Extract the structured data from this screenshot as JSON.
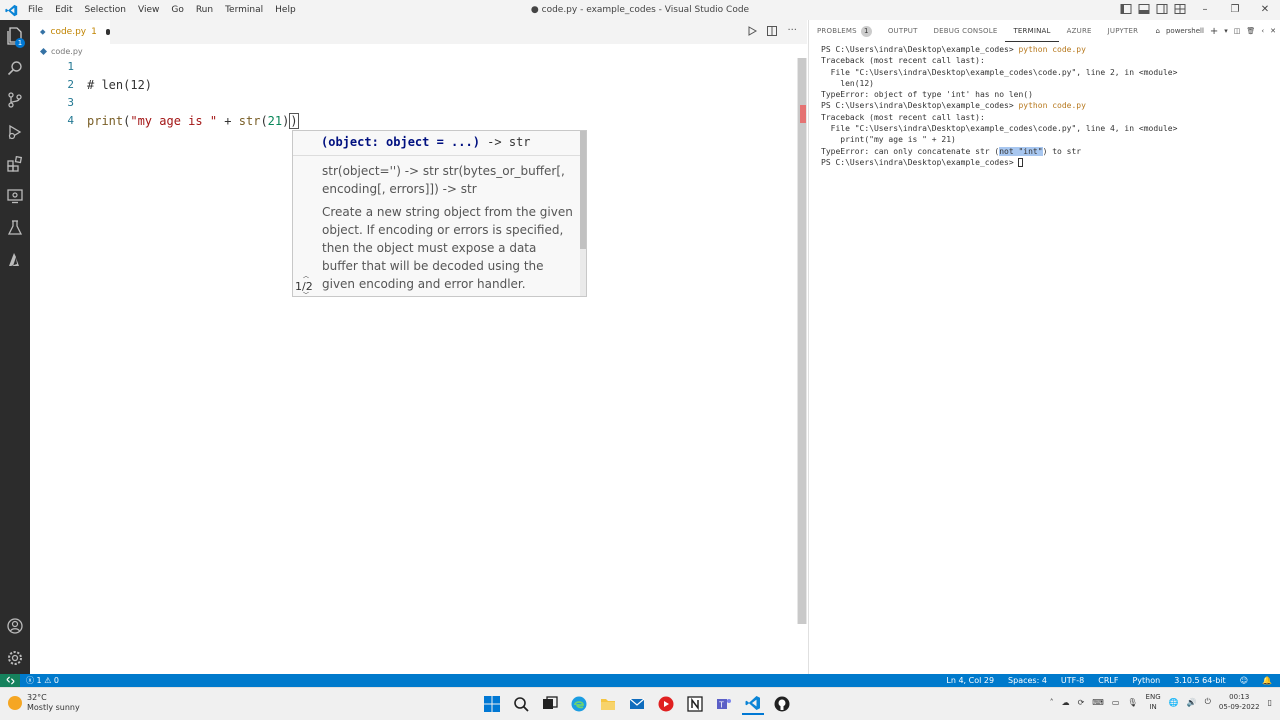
{
  "window": {
    "title": "● code.py - example_codes - Visual Studio Code",
    "menu": [
      "File",
      "Edit",
      "Selection",
      "View",
      "Go",
      "Run",
      "Terminal",
      "Help"
    ]
  },
  "activity_bar": {
    "explorer_badge": "1",
    "items": [
      "explorer-icon",
      "search-icon",
      "source-control-icon",
      "run-debug-icon",
      "extensions-icon",
      "remote-explorer-icon",
      "testing-icon",
      "azure-icon",
      "account-icon",
      "settings-gear-icon"
    ]
  },
  "editor": {
    "tab": {
      "filename": "code.py",
      "problem_count": "1"
    },
    "breadcrumb": "code.py",
    "lines": [
      {
        "number": "1",
        "text": ""
      },
      {
        "number": "2",
        "text": "# len(12)"
      },
      {
        "number": "3",
        "text": ""
      },
      {
        "number": "4",
        "text": "print(\"my age is \" + str(21))"
      }
    ],
    "line4": {
      "fn": "print",
      "open": "(",
      "str": "\"my age is \"",
      "plus": " + ",
      "str_fn": "str",
      "open2": "(",
      "num": "21",
      "close2": ")",
      "close": ")"
    },
    "hover": {
      "sig_param": "(object: object = ...)",
      "sig_ret": " -> str",
      "overloads": "str(object='') -> str str(bytes_or_buffer[, encoding[, errors]]) -> str",
      "doc": "Create a new string object from the given object. If encoding or errors is specified, then the object must expose a data buffer that will be decoded using the given encoding and error handler. Otherwise, returns the result of object.__str__() (if",
      "pager": "1/2"
    }
  },
  "panel": {
    "tabs": [
      "PROBLEMS",
      "OUTPUT",
      "DEBUG CONSOLE",
      "TERMINAL",
      "AZURE",
      "JUPYTER"
    ],
    "problems_badge": "1",
    "active_tab": "TERMINAL",
    "shell": "powershell",
    "terminal": {
      "prompt": "PS C:\\Users\\indra\\Desktop\\example_codes>",
      "cmd": "python code.py",
      "tb1": [
        "Traceback (most recent call last):",
        "  File \"C:\\Users\\indra\\Desktop\\example_codes\\code.py\", line 2, in <module>",
        "    len(12)",
        "TypeError: object of type 'int' has no len()"
      ],
      "tb2": [
        "Traceback (most recent call last):",
        "  File \"C:\\Users\\indra\\Desktop\\example_codes\\code.py\", line 4, in <module>",
        "    print(\"my age is \" + 21)"
      ],
      "err_pre": "TypeError: can only concatenate str (",
      "err_hl": "not \"int\"",
      "err_post": ") to str"
    }
  },
  "statusbar": {
    "errors": "1",
    "warnings": "0",
    "position": "Ln 4, Col 29",
    "spaces": "Spaces: 4",
    "encoding": "UTF-8",
    "eol": "CRLF",
    "language": "Python",
    "interpreter": "3.10.5 64-bit"
  },
  "taskbar": {
    "temp": "32°C",
    "weather": "Mostly sunny",
    "lang1": "ENG",
    "lang2": "IN",
    "time": "00:13",
    "date": "05-09-2022"
  },
  "colors": {
    "accent": "#007acc",
    "activity_bar": "#2c2c2c",
    "remote": "#16825d"
  }
}
